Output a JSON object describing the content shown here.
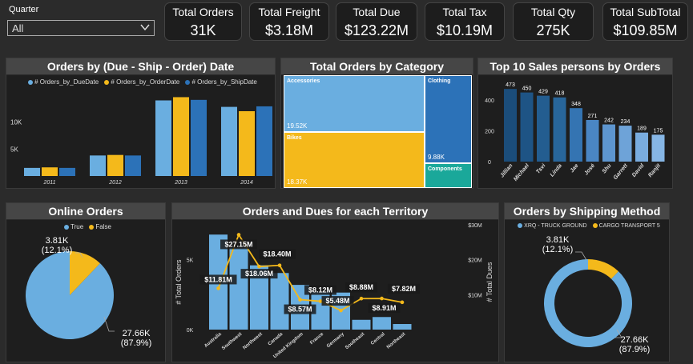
{
  "filter": {
    "label": "Quarter",
    "value": "All"
  },
  "kpis": [
    {
      "label": "Total Orders",
      "value": "31K"
    },
    {
      "label": "Total Freight",
      "value": "$3.18M"
    },
    {
      "label": "Total Due",
      "value": "$123.22M"
    },
    {
      "label": "Total Tax",
      "value": "$10.19M"
    },
    {
      "label": "Total Qty",
      "value": "275K"
    },
    {
      "label": "Total SubTotal",
      "value": "$109.85M"
    }
  ],
  "colors": {
    "blue": "#6aaee0",
    "yellow": "#f4b91b",
    "dark_blue": "#2c72b8",
    "green": "#1aa89a",
    "navy": "#1c4f7d"
  },
  "panels": {
    "dates": "Orders by (Due - Ship - Order) Date",
    "category": "Total Orders by Category",
    "sales": "Top 10 Sales persons by Orders",
    "online": "Online Orders",
    "territory": "Orders and Dues for each Territory",
    "shipping": "Orders by Shipping Method"
  },
  "chart_data": [
    {
      "type": "bar",
      "categories": [
        "2011",
        "2012",
        "2013",
        "2014"
      ],
      "series": [
        {
          "name": "# Orders_by_DueDate",
          "values": [
            1500,
            3800,
            14000,
            12800
          ]
        },
        {
          "name": "# Orders_by_OrderDate",
          "values": [
            1600,
            3900,
            14600,
            12000
          ]
        },
        {
          "name": "# Orders_by_ShipDate",
          "values": [
            1500,
            3800,
            14100,
            12900
          ]
        }
      ],
      "ylim": [
        0,
        16000
      ],
      "yticks": [
        "5K",
        "10K"
      ]
    },
    {
      "type": "treemap",
      "items": [
        {
          "name": "Accessories",
          "value_label": "19.52K"
        },
        {
          "name": "Bikes",
          "value_label": "18.37K"
        },
        {
          "name": "Clothing",
          "value_label": "9.88K"
        },
        {
          "name": "Components",
          "value_label": ""
        }
      ]
    },
    {
      "type": "bar",
      "categories": [
        "Jillian",
        "Michael",
        "Tsvi",
        "Linda",
        "Jae",
        "José",
        "Shu",
        "Garrett",
        "David",
        "Ranjit"
      ],
      "values": [
        473,
        450,
        429,
        418,
        348,
        271,
        242,
        234,
        189,
        175
      ],
      "ylim": [
        0,
        500
      ],
      "yticks": [
        "0",
        "200",
        "400"
      ]
    },
    {
      "type": "pie",
      "legend": [
        "True",
        "False"
      ],
      "values": [
        27660,
        3810
      ],
      "labels": [
        "27.66K\n(87.9%)",
        "3.81K\n(12.1%)"
      ]
    },
    {
      "type": "bar+line",
      "categories": [
        "Australia",
        "Southwest",
        "Northwest",
        "Canada",
        "United Kingdom",
        "France",
        "Germany",
        "Southeast",
        "Central",
        "Northeast"
      ],
      "orders": [
        6800,
        5850,
        4600,
        4050,
        3200,
        2700,
        2650,
        700,
        900,
        400
      ],
      "dues_labels": [
        "$11.81M",
        "$27.15M",
        "$18.06M",
        "$18.40M",
        "$8.57M",
        "$8.12M",
        "$5.48M",
        "$8.88M",
        "$8.91M",
        "$7.82M"
      ],
      "dues": [
        11.81,
        27.15,
        18.06,
        18.4,
        8.57,
        8.12,
        5.48,
        8.88,
        8.91,
        7.82
      ],
      "left_yticks": [
        "0K",
        "5K"
      ],
      "right_yticks": [
        "$10M",
        "$20M",
        "$30M"
      ],
      "ylabel_left": "# Total Orders",
      "ylabel_right": "# Total Dues"
    },
    {
      "type": "donut",
      "legend": [
        "XRQ - TRUCK GROUND",
        "CARGO TRANSPORT 5"
      ],
      "values": [
        27660,
        3810
      ],
      "labels": [
        "27.66K\n(87.9%)",
        "3.81K\n(12.1%)"
      ]
    }
  ]
}
